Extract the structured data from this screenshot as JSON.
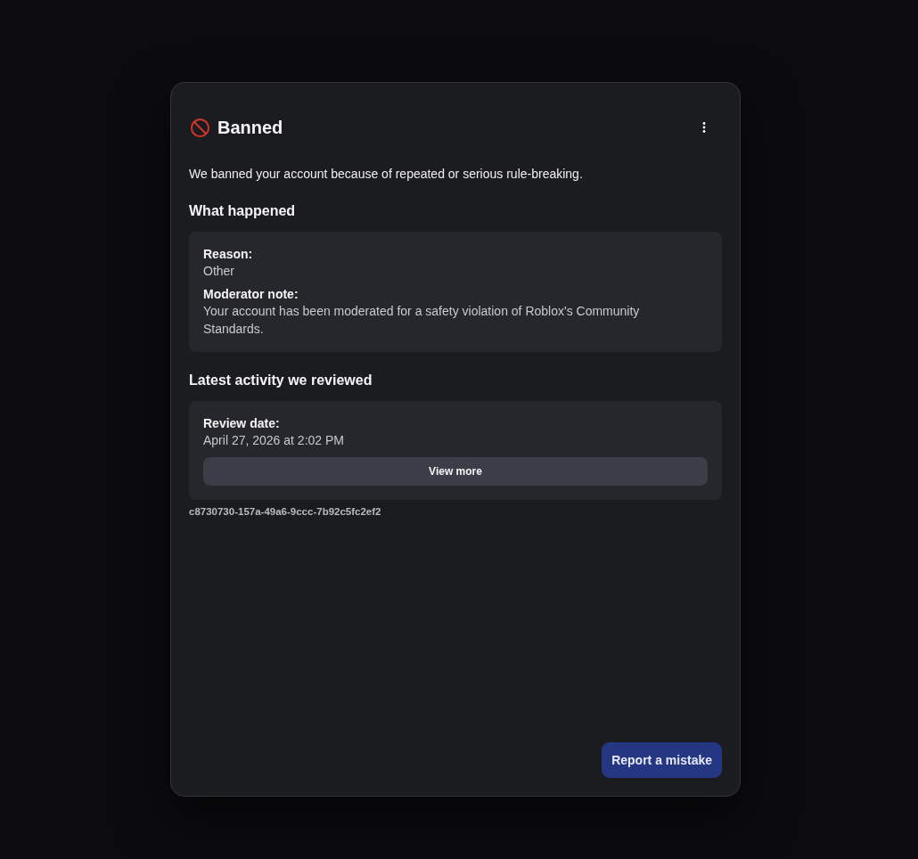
{
  "header": {
    "title": "Banned"
  },
  "summary": "We banned your account because of repeated or serious rule-breaking.",
  "sections": [
    {
      "heading": "What happened",
      "fields": [
        {
          "label": "Reason:",
          "value": "Other"
        },
        {
          "label": "Moderator note:",
          "value": "Your account has been moderated for a safety violation of Roblox's Community Standards."
        }
      ]
    },
    {
      "heading": "Latest activity we reviewed",
      "fields": [
        {
          "label": "Review date:",
          "value": "April 27, 2026 at 2:02 PM"
        }
      ],
      "button": "View more"
    }
  ],
  "reference_id": "c8730730-157a-49a6-9ccc-7b92c5fc2ef2",
  "footer_button": "Report a mistake"
}
